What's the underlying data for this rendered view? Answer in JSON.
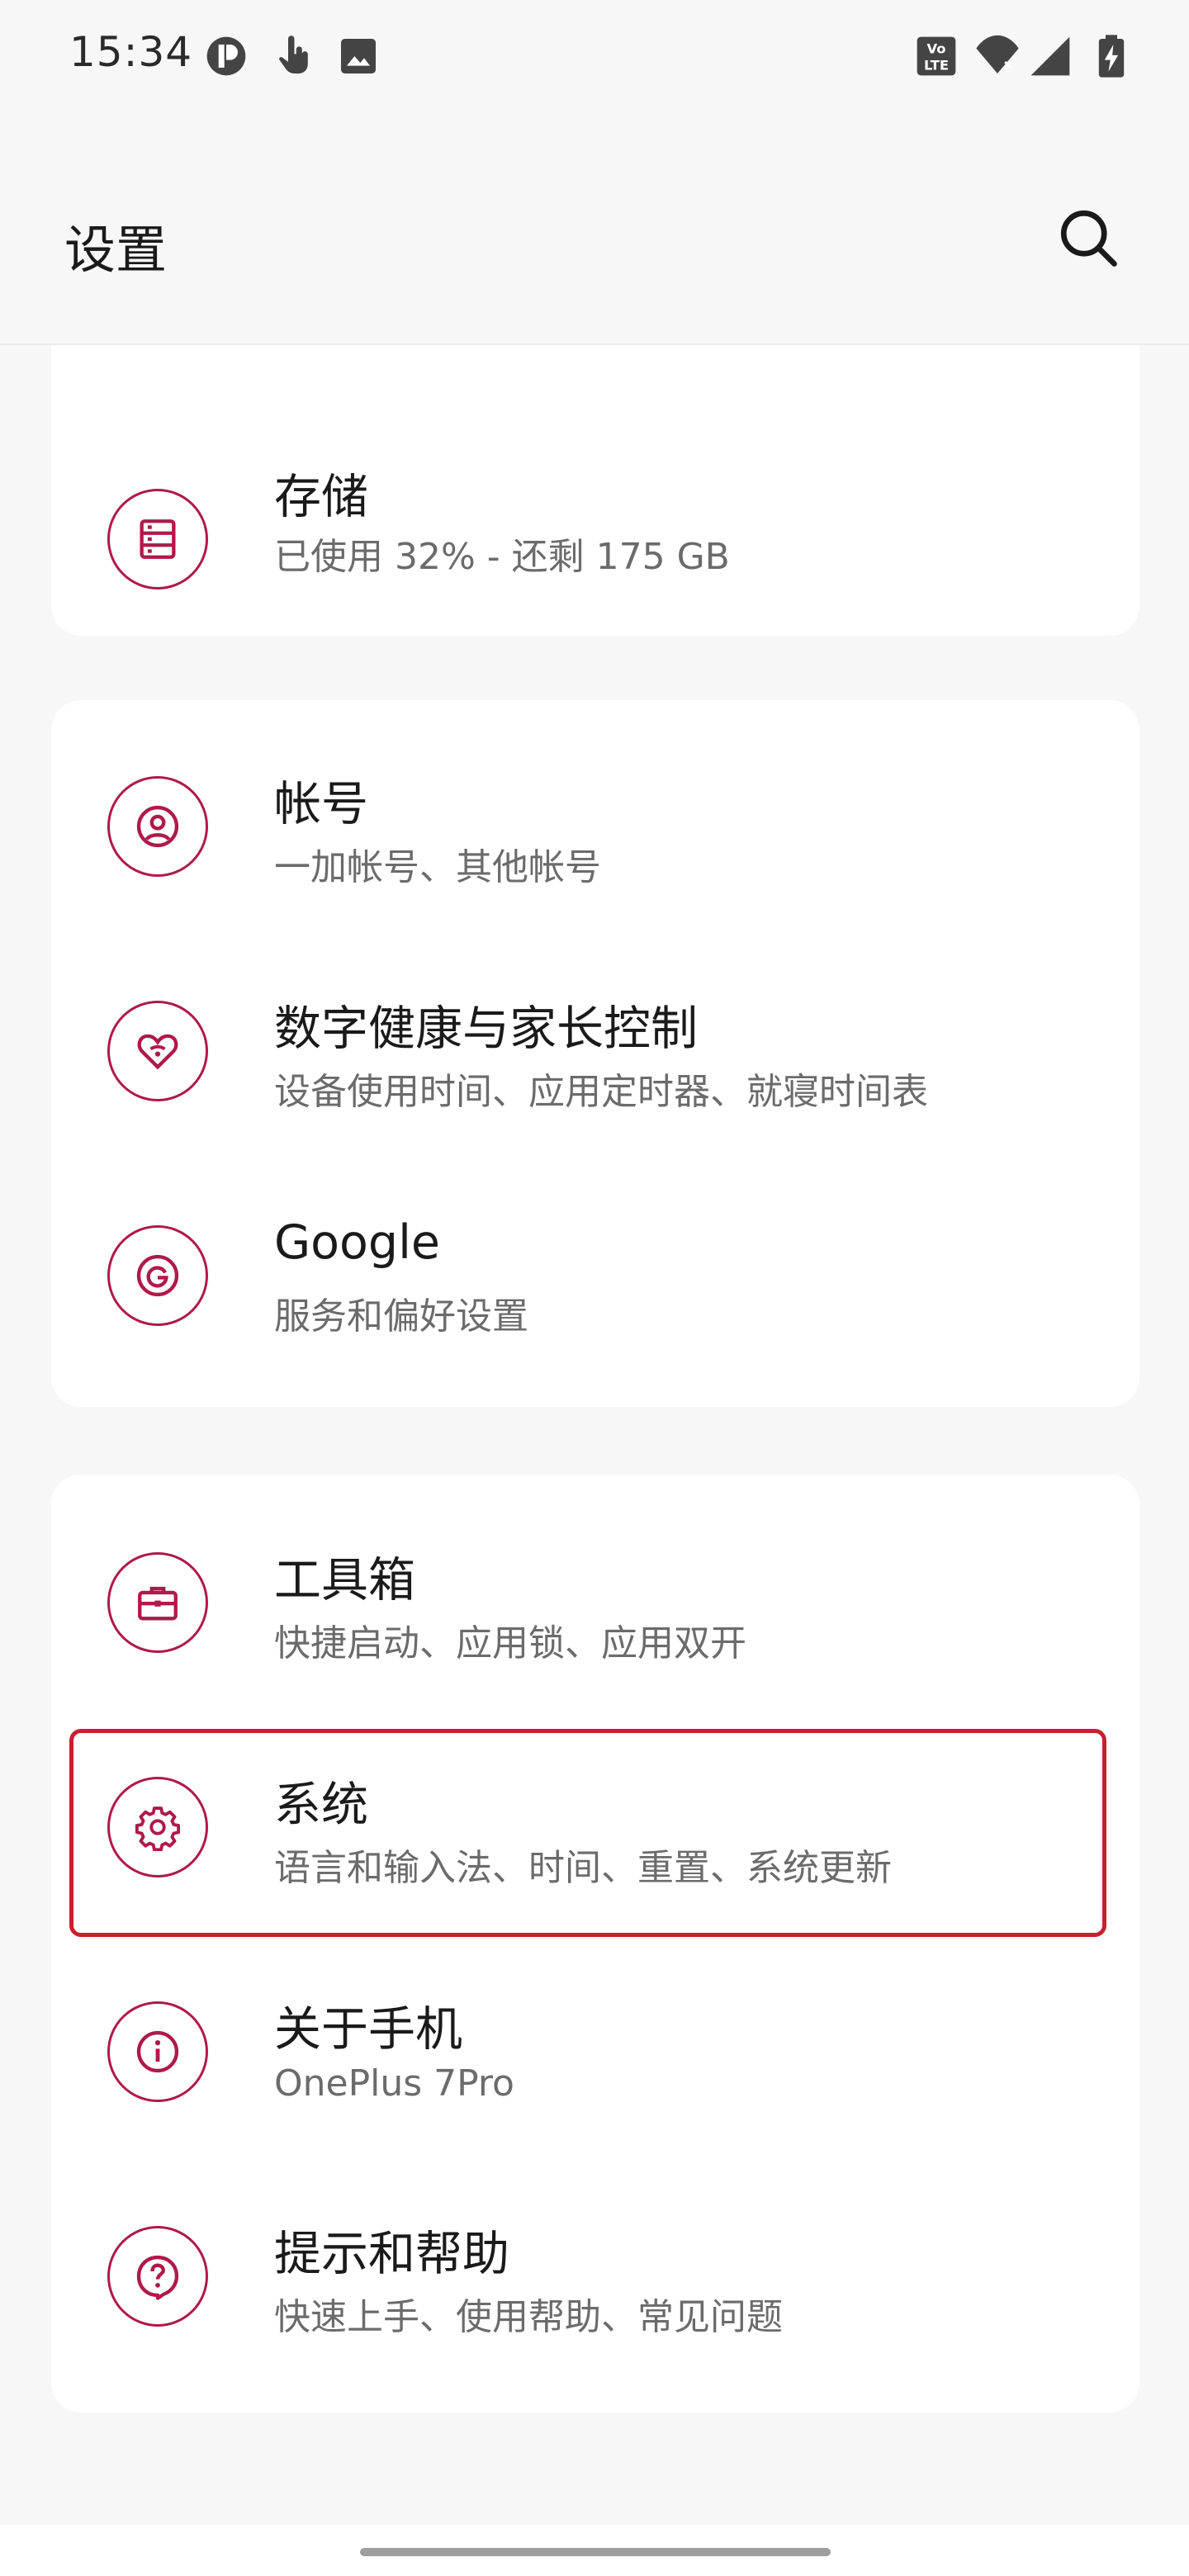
{
  "status_bar": {
    "time": "15:34",
    "left_icons": [
      "app-notification-icon",
      "touch-gesture-icon",
      "image-icon"
    ],
    "right_icons": [
      "volte-icon",
      "wifi-icon",
      "cellular-signal-icon",
      "battery-charging-icon"
    ]
  },
  "header": {
    "title": "设置",
    "search_icon": "search-icon"
  },
  "accent_color": "#b0194a",
  "highlight_color": "#c8202f",
  "cards": [
    {
      "items": [
        {
          "icon": "storage-icon",
          "title": "存储",
          "subtitle": "已使用 32% - 还剩 175 GB"
        }
      ]
    },
    {
      "items": [
        {
          "icon": "account-icon",
          "title": "帐号",
          "subtitle": "一加帐号、其他帐号"
        },
        {
          "icon": "digital-wellbeing-icon",
          "title": "数字健康与家长控制",
          "subtitle": "设备使用时间、应用定时器、就寝时间表"
        },
        {
          "icon": "google-icon",
          "title": "Google",
          "subtitle": "服务和偏好设置"
        }
      ]
    },
    {
      "items": [
        {
          "icon": "toolbox-icon",
          "title": "工具箱",
          "subtitle": "快捷启动、应用锁、应用双开"
        },
        {
          "icon": "system-gear-icon",
          "title": "系统",
          "subtitle": "语言和输入法、时间、重置、系统更新"
        },
        {
          "icon": "about-phone-icon",
          "title": "关于手机",
          "subtitle": "OnePlus 7Pro"
        },
        {
          "icon": "help-icon",
          "title": "提示和帮助",
          "subtitle": "快速上手、使用帮助、常见问题"
        }
      ]
    }
  ]
}
